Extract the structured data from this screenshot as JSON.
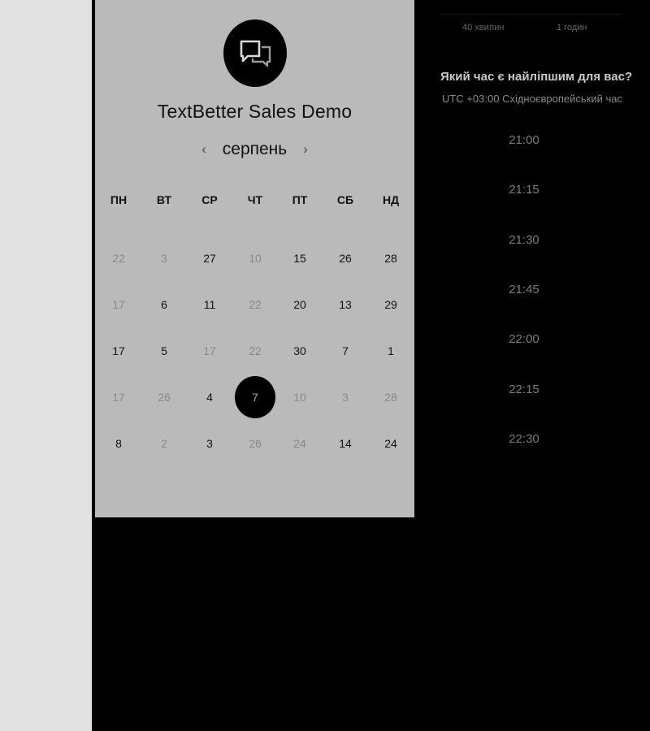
{
  "scheduler": {
    "title": "TextBetter Sales Demo",
    "month": "серпень",
    "prev_glyph": "‹",
    "next_glyph": "›",
    "logo_icon": "chat-bubbles-icon",
    "weekdays": [
      "ПН",
      "ВТ",
      "СР",
      "ЧТ",
      "ПТ",
      "СБ",
      "НД"
    ],
    "weeks": [
      [
        {
          "d": "22",
          "s": "out"
        },
        {
          "d": "3",
          "s": "out"
        },
        {
          "d": "27",
          "s": "in"
        },
        {
          "d": "10",
          "s": "out"
        },
        {
          "d": "15",
          "s": "in"
        },
        {
          "d": "26",
          "s": "in"
        },
        {
          "d": "28",
          "s": "in"
        }
      ],
      [
        {
          "d": "17",
          "s": "out"
        },
        {
          "d": "6",
          "s": "in"
        },
        {
          "d": "11",
          "s": "in"
        },
        {
          "d": "22",
          "s": "out"
        },
        {
          "d": "20",
          "s": "in"
        },
        {
          "d": "13",
          "s": "in"
        },
        {
          "d": "29",
          "s": "in"
        }
      ],
      [
        {
          "d": "17",
          "s": "in"
        },
        {
          "d": "5",
          "s": "in"
        },
        {
          "d": "17",
          "s": "out"
        },
        {
          "d": "22",
          "s": "out"
        },
        {
          "d": "30",
          "s": "in"
        },
        {
          "d": "7",
          "s": "in"
        },
        {
          "d": "1",
          "s": "in"
        }
      ],
      [
        {
          "d": "17",
          "s": "out"
        },
        {
          "d": "26",
          "s": "out"
        },
        {
          "d": "4",
          "s": "in"
        },
        {
          "d": "7",
          "s": "sel"
        },
        {
          "d": "10",
          "s": "out"
        },
        {
          "d": "3",
          "s": "out"
        },
        {
          "d": "28",
          "s": "out"
        }
      ],
      [
        {
          "d": "8",
          "s": "in"
        },
        {
          "d": "2",
          "s": "out"
        },
        {
          "d": "3",
          "s": "in"
        },
        {
          "d": "26",
          "s": "out"
        },
        {
          "d": "24",
          "s": "out"
        },
        {
          "d": "14",
          "s": "in"
        },
        {
          "d": "24",
          "s": "in"
        }
      ]
    ]
  },
  "time_panel": {
    "durations": [
      "40 хвилин",
      "1 годин"
    ],
    "question": "Який час є найліпшим для вас?",
    "timezone": "UTC +03:00 Східноєвропейський час",
    "slots": [
      "21:00",
      "21:15",
      "21:30",
      "21:45",
      "22:00",
      "22:15",
      "22:30"
    ]
  }
}
